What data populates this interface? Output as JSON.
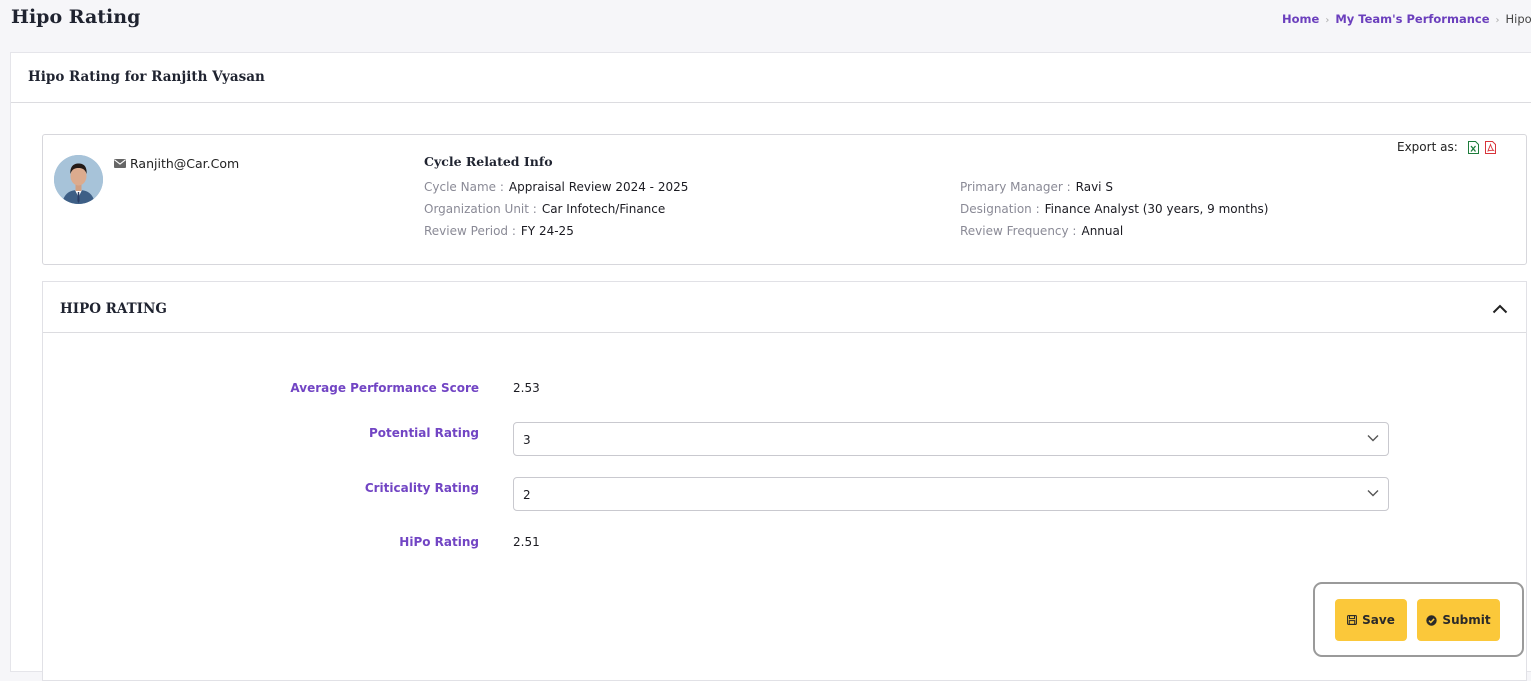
{
  "page": {
    "title": "Hipo Rating"
  },
  "breadcrumb": {
    "home": "Home",
    "team": "My Team's Performance",
    "current": "Hipo Rating"
  },
  "main_card": {
    "header": "Hipo Rating for Ranjith Vyasan"
  },
  "employee": {
    "email": "Ranjith@Car.Com"
  },
  "cycle_info": {
    "title": "Cycle Related Info",
    "cycle_name_label": "Cycle Name :",
    "cycle_name": "Appraisal Review 2024 - 2025",
    "org_unit_label": "Organization Unit :",
    "org_unit": "Car Infotech/Finance",
    "review_period_label": "Review Period :",
    "review_period": "FY 24-25",
    "primary_manager_label": "Primary Manager :",
    "primary_manager": "Ravi S",
    "designation_label": "Designation :",
    "designation": "Finance Analyst (30 years, 9 months)",
    "review_frequency_label": "Review Frequency :",
    "review_frequency": "Annual"
  },
  "export": {
    "label": "Export as:",
    "icons": [
      "excel-icon",
      "pdf-icon"
    ]
  },
  "hipo": {
    "title": "HIPO RATING",
    "avg_score_label": "Average Performance Score",
    "avg_score": "2.53",
    "potential_label": "Potential Rating",
    "potential_value": "3",
    "criticality_label": "Criticality Rating",
    "criticality_value": "2",
    "hipo_rating_label": "HiPo Rating",
    "hipo_rating": "2.51"
  },
  "actions": {
    "save": "Save",
    "submit": "Submit"
  },
  "colors": {
    "accent": "#7245c4",
    "button": "#fbc83a",
    "breadcrumb_link": "#6b3fbd"
  }
}
